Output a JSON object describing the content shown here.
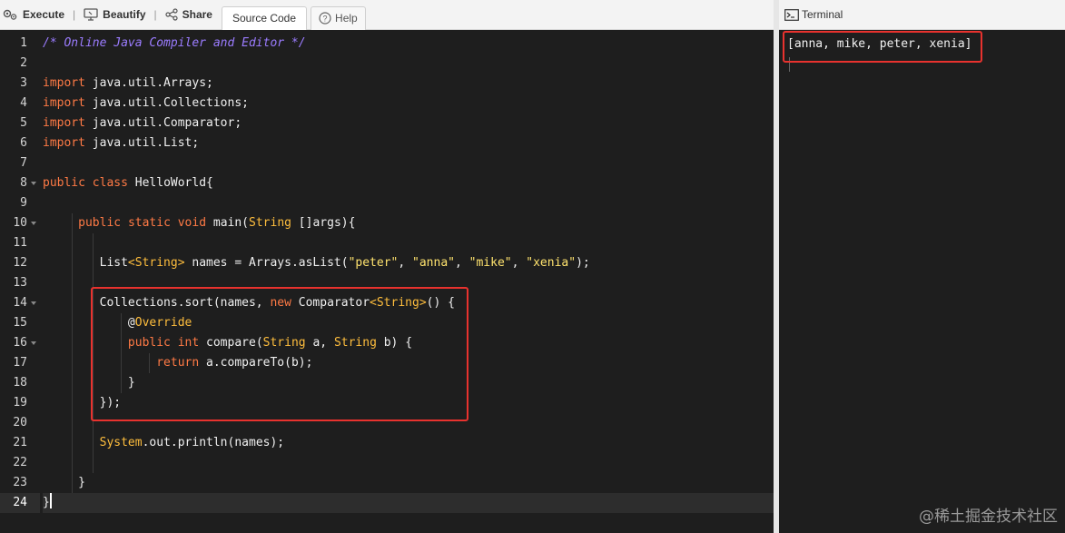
{
  "toolbar": {
    "execute_label": "Execute",
    "beautify_label": "Beautify",
    "share_label": "Share",
    "source_code_tab": "Source Code",
    "help_label": "Help",
    "separator": "|"
  },
  "editor": {
    "lines": [
      {
        "num": "1",
        "html": "<span class=\"cm\">/* Online Java Compiler and Editor */</span>"
      },
      {
        "num": "2",
        "html": ""
      },
      {
        "num": "3",
        "html": "<span class=\"kw\">import</span> java.util.Arrays;"
      },
      {
        "num": "4",
        "html": "<span class=\"kw\">import</span> java.util.Collections;"
      },
      {
        "num": "5",
        "html": "<span class=\"kw\">import</span> java.util.Comparator;"
      },
      {
        "num": "6",
        "html": "<span class=\"kw\">import</span> java.util.List;"
      },
      {
        "num": "7",
        "html": ""
      },
      {
        "num": "8",
        "fold": true,
        "html": "<span class=\"kw\">public</span> <span class=\"kw\">class</span> HelloWorld{"
      },
      {
        "num": "9",
        "html": ""
      },
      {
        "num": "10",
        "fold": true,
        "html": "     <span class=\"kw\">public</span> <span class=\"kw\">static</span> <span class=\"kw\">void</span> main(<span class=\"ty\">String</span> []args){"
      },
      {
        "num": "11",
        "html": ""
      },
      {
        "num": "12",
        "html": "        List<span class=\"gen\">&lt;String&gt;</span> names = Arrays.asList(<span class=\"st\">\"peter\"</span>, <span class=\"st\">\"anna\"</span>, <span class=\"st\">\"mike\"</span>, <span class=\"st\">\"xenia\"</span>);"
      },
      {
        "num": "13",
        "html": ""
      },
      {
        "num": "14",
        "fold": true,
        "html": "        Collections.sort(names, <span class=\"kw\">new</span> Comparator<span class=\"gen\">&lt;String&gt;</span>() {"
      },
      {
        "num": "15",
        "html": "            @<span class=\"an\">Override</span>"
      },
      {
        "num": "16",
        "fold": true,
        "html": "            <span class=\"kw\">public</span> <span class=\"kw\">int</span> compare(<span class=\"ty\">String</span> a, <span class=\"ty\">String</span> b) {"
      },
      {
        "num": "17",
        "html": "                <span class=\"kw\">return</span> a.compareTo(b);"
      },
      {
        "num": "18",
        "html": "            }"
      },
      {
        "num": "19",
        "html": "        });"
      },
      {
        "num": "20",
        "html": ""
      },
      {
        "num": "21",
        "html": "        <span class=\"ty\">System</span>.out.println(names);"
      },
      {
        "num": "22",
        "html": ""
      },
      {
        "num": "23",
        "html": "     }"
      },
      {
        "num": "24",
        "active": true,
        "html": "}<span class=\"caret\"></span>"
      }
    ]
  },
  "terminal": {
    "title": "Terminal",
    "output": "[anna, mike, peter, xenia]"
  },
  "watermark": "@稀土掘金技术社区"
}
